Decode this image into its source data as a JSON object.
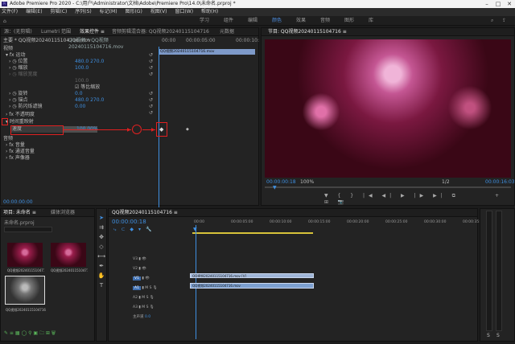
{
  "window": {
    "title": "Adobe Premiere Pro 2020 - C:\\用户\\Administrator\\文档\\Adobe\\Premiere Pro\\14.0\\未命名.prproj *"
  },
  "menu": [
    "文件(F)",
    "编辑(E)",
    "剪辑(C)",
    "序列(S)",
    "标记(M)",
    "图形(G)",
    "视图(V)",
    "窗口(W)",
    "帮助(H)"
  ],
  "workspaces": [
    "学习",
    "组件",
    "编辑",
    "颜色",
    "效果",
    "音频",
    "图形",
    "库"
  ],
  "source_panel": {
    "tabs": [
      "源：(无剪辑)",
      "Lumetri 范围",
      "效果控件 ≡",
      "音频剪辑混合器: QQ视频20240115104716",
      "元数据"
    ],
    "master": "主要 * QQ视频20240115104716.mov",
    "clip": "QQ视频 * QQ视频20240115104716.mov",
    "times": [
      "00:00",
      "00:00:05:00",
      "00:00:10:"
    ],
    "timeline_clip": "QQ视频20240115104716.mov",
    "sections": [
      "视频",
      "运动",
      "位置",
      "缩放",
      "缩放宽度",
      "等比缩放",
      "旋转",
      "锚点",
      "防闪烁滤镜",
      "不透明度",
      "时间重映射",
      "速度",
      "音频",
      "音量",
      "通道音量",
      "声像器"
    ],
    "values": {
      "position": "480.0   270.0",
      "scale": "100.0",
      "scale_width": "100.0",
      "uniform": "等比缩放",
      "rotation": "0.0",
      "anchor": "480.0   270.0",
      "antiflicker": "0.00",
      "speed": "100.00%"
    },
    "timecode": "00:00:00:00"
  },
  "program": {
    "tab": "节目: QQ视频20240115104716 ≡",
    "timecode": "00:00:00:18",
    "zoom": "100%",
    "quality": "1/2",
    "duration": "00:00:16:03"
  },
  "project": {
    "tabs": [
      "项目: 未命名 ≡",
      "媒体浏览器"
    ],
    "filename": "未命名.prproj",
    "items": [
      {
        "name": "QQ视频20240115104716...",
        "dur": "16:03"
      },
      {
        "name": "QQ视频20240115104716...",
        "dur": "16:03"
      },
      {
        "name": "QQ视频20240115104716",
        "dur": "16:03"
      }
    ]
  },
  "timeline": {
    "tab": "QQ视频20240115104716 ≡",
    "timecode": "00:00:00:18",
    "ruler": [
      "00:00",
      "00:00:05:00",
      "00:00:10:00",
      "00:00:15:00",
      "00:00:20:00",
      "00:00:25:00",
      "00:00:30:00",
      "00:00:35:00"
    ],
    "tracks": [
      "V3",
      "V2",
      "V1",
      "A1",
      "A2",
      "A3",
      "主声道"
    ],
    "master_val": "0.0",
    "video_clip": "QQ视频20240115104716.mov [V]",
    "audio_clip": "QQ视频20240115104716.mov"
  },
  "meters": {
    "labels": [
      "S",
      "S"
    ]
  }
}
